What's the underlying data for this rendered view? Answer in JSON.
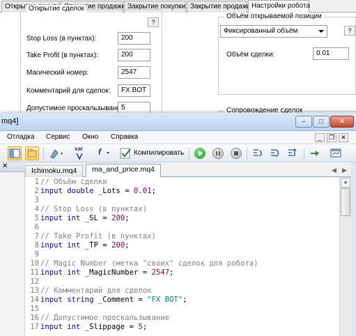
{
  "settings_dialog": {
    "tabs": [
      {
        "label": "Открытие покупки"
      },
      {
        "label": "Открытие продажи"
      },
      {
        "label": "Закрытие покупки"
      },
      {
        "label": "Закрытие продажи"
      },
      {
        "label": "Настройки робота"
      }
    ],
    "group_open": {
      "title": "Открытие сделок",
      "help": "?",
      "fields": [
        {
          "label": "Stop Loss (в пунктах):",
          "value": "200"
        },
        {
          "label": "Take Profit (в пунктах):",
          "value": "200"
        },
        {
          "label": "Магический номер:",
          "value": "2547"
        },
        {
          "label": "Комментарий для сделок:",
          "value": "FX BOT"
        },
        {
          "label": "Допустимое проскальзывание:",
          "value": "5"
        }
      ]
    },
    "group_volume": {
      "title": "Объём открываемой позиции",
      "help": "?",
      "mode_value": "Фиксированный объём",
      "lot_label": "Объём сделки:",
      "lot_value": "0.01"
    },
    "group_support": {
      "title": "Сопровождение сделок"
    }
  },
  "editor": {
    "title": "mq4]",
    "window_buttons": {
      "minimize": "–",
      "maximize": "□",
      "close": "✕"
    },
    "menu": [
      {
        "label": "Отладка"
      },
      {
        "label": "Сервис"
      },
      {
        "label": "Окно"
      },
      {
        "label": "Справка"
      }
    ],
    "mdi_controls": {
      "minimize": "_",
      "restore": "❐",
      "close": "✕"
    },
    "toolbar": {
      "compile_label": "Компилировать",
      "var_label": "var",
      "f_label": "f"
    },
    "left_panel_close": "✕",
    "doc_tabs": [
      {
        "label": "Ichimoku.mq4",
        "active": false
      },
      {
        "label": "ma_and_price.mq4",
        "active": true
      }
    ],
    "tab_scroll": {
      "left": "◀",
      "right": "▶"
    },
    "code_lines": [
      {
        "n": "1",
        "parts": [
          {
            "t": "// Объём сделки",
            "c": "cm"
          }
        ]
      },
      {
        "n": "2",
        "parts": [
          {
            "t": "input double",
            "c": "kw"
          },
          {
            "t": " _Lots = ",
            "c": ""
          },
          {
            "t": "0.01",
            "c": "num"
          },
          {
            "t": ";",
            "c": ""
          }
        ]
      },
      {
        "n": "3",
        "parts": []
      },
      {
        "n": "4",
        "parts": [
          {
            "t": "// Stop Loss (в пунктах)",
            "c": "cm"
          }
        ]
      },
      {
        "n": "5",
        "parts": [
          {
            "t": "input int",
            "c": "kw"
          },
          {
            "t": " _SL = ",
            "c": ""
          },
          {
            "t": "200",
            "c": "num"
          },
          {
            "t": ";",
            "c": ""
          }
        ]
      },
      {
        "n": "6",
        "parts": []
      },
      {
        "n": "7",
        "parts": [
          {
            "t": "// Take Profit (в пунктах)",
            "c": "cm"
          }
        ]
      },
      {
        "n": "8",
        "parts": [
          {
            "t": "input int",
            "c": "kw"
          },
          {
            "t": " _TP = ",
            "c": ""
          },
          {
            "t": "200",
            "c": "num"
          },
          {
            "t": ";",
            "c": ""
          }
        ]
      },
      {
        "n": "9",
        "parts": []
      },
      {
        "n": "10",
        "parts": [
          {
            "t": "// Magic Number (метка \"своих\" сделок для робота)",
            "c": "cm"
          }
        ]
      },
      {
        "n": "11",
        "parts": [
          {
            "t": "input int",
            "c": "kw"
          },
          {
            "t": " _MagicNumber = ",
            "c": ""
          },
          {
            "t": "2547",
            "c": "num"
          },
          {
            "t": ";",
            "c": ""
          }
        ]
      },
      {
        "n": "12",
        "parts": []
      },
      {
        "n": "13",
        "parts": [
          {
            "t": "// Комментарий для сделок",
            "c": "cm"
          }
        ]
      },
      {
        "n": "14",
        "parts": [
          {
            "t": "input string",
            "c": "kw"
          },
          {
            "t": " _Comment = ",
            "c": ""
          },
          {
            "t": "\"FX BOT\"",
            "c": "str"
          },
          {
            "t": ";",
            "c": ""
          }
        ]
      },
      {
        "n": "15",
        "parts": []
      },
      {
        "n": "16",
        "parts": [
          {
            "t": "// Допустимое проскальзывание",
            "c": "cm"
          }
        ]
      },
      {
        "n": "17",
        "parts": [
          {
            "t": "input int",
            "c": "kw"
          },
          {
            "t": " _Slippage = ",
            "c": ""
          },
          {
            "t": "5",
            "c": "num"
          },
          {
            "t": ";",
            "c": ""
          }
        ]
      }
    ],
    "scrollbar": {
      "up": "▲",
      "down": "▼"
    }
  },
  "colors": {
    "keyword": "#0000cc",
    "comment": "#808080",
    "number": "#7f0055",
    "string": "#008080",
    "titlebar": "#bcd4ee"
  }
}
